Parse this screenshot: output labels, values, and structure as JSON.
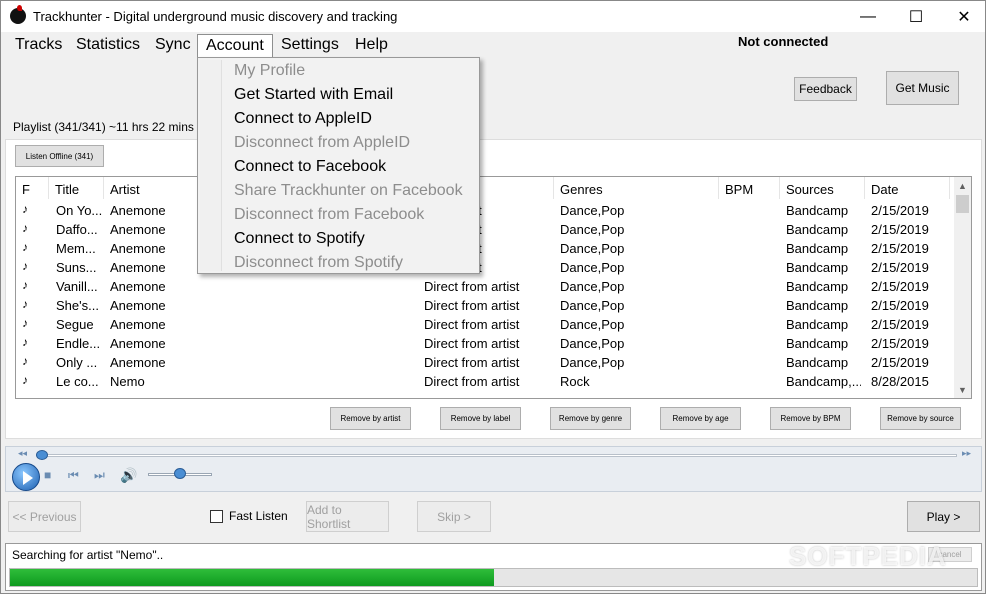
{
  "window": {
    "title": "Trackhunter - Digital underground music discovery and tracking",
    "controls": {
      "minimize": "—",
      "maximize": "☐",
      "close": "✕"
    }
  },
  "menubar": {
    "items": [
      "Tracks",
      "Statistics",
      "Sync",
      "Account",
      "Settings",
      "Help"
    ],
    "active": "Account"
  },
  "connection_status": "Not connected",
  "buttons": {
    "feedback": "Feedback",
    "get_music": "Get Music",
    "listen_offline": "Listen Offline (341)"
  },
  "playlist": {
    "label": "Playlist (341/341)   ~11 hrs 22 mins 0 s"
  },
  "account_menu": {
    "items": [
      {
        "label": "My Profile",
        "enabled": false
      },
      {
        "label": "Get Started with Email",
        "enabled": true
      },
      {
        "label": "Connect to AppleID",
        "enabled": true
      },
      {
        "label": "Disconnect from AppleID",
        "enabled": false
      },
      {
        "label": "Connect to Facebook",
        "enabled": true
      },
      {
        "label": "Share Trackhunter on Facebook",
        "enabled": false
      },
      {
        "label": "Disconnect from Facebook",
        "enabled": false
      },
      {
        "label": "Connect to Spotify",
        "enabled": true
      },
      {
        "label": "Disconnect from Spotify",
        "enabled": false
      }
    ]
  },
  "table": {
    "columns": [
      "F",
      "Title",
      "Artist",
      "Genres",
      "BPM",
      "Sources",
      "Date"
    ],
    "rows": [
      {
        "title": "On Yo...",
        "artist": "Anemone",
        "label": "from artist",
        "genres": "Dance,Pop",
        "bpm": "",
        "sources": "Bandcamp",
        "date": "2/15/2019"
      },
      {
        "title": "Daffo...",
        "artist": "Anemone",
        "label": "from artist",
        "genres": "Dance,Pop",
        "bpm": "",
        "sources": "Bandcamp",
        "date": "2/15/2019"
      },
      {
        "title": "Mem...",
        "artist": "Anemone",
        "label": "from artist",
        "genres": "Dance,Pop",
        "bpm": "",
        "sources": "Bandcamp",
        "date": "2/15/2019"
      },
      {
        "title": "Suns...",
        "artist": "Anemone",
        "label": "from artist",
        "genres": "Dance,Pop",
        "bpm": "",
        "sources": "Bandcamp",
        "date": "2/15/2019"
      },
      {
        "title": "Vanill...",
        "artist": "Anemone",
        "label": "Direct from artist",
        "genres": "Dance,Pop",
        "bpm": "",
        "sources": "Bandcamp",
        "date": "2/15/2019"
      },
      {
        "title": "She's...",
        "artist": "Anemone",
        "label": "Direct from artist",
        "genres": "Dance,Pop",
        "bpm": "",
        "sources": "Bandcamp",
        "date": "2/15/2019"
      },
      {
        "title": "Segue",
        "artist": "Anemone",
        "label": "Direct from artist",
        "genres": "Dance,Pop",
        "bpm": "",
        "sources": "Bandcamp",
        "date": "2/15/2019"
      },
      {
        "title": "Endle...",
        "artist": "Anemone",
        "label": "Direct from artist",
        "genres": "Dance,Pop",
        "bpm": "",
        "sources": "Bandcamp",
        "date": "2/15/2019"
      },
      {
        "title": "Only ...",
        "artist": "Anemone",
        "label": "Direct from artist",
        "genres": "Dance,Pop",
        "bpm": "",
        "sources": "Bandcamp",
        "date": "2/15/2019"
      },
      {
        "title": "Le co...",
        "artist": "Nemo",
        "label": "Direct from artist",
        "genres": "Rock",
        "bpm": "",
        "sources": "Bandcamp,...",
        "date": "8/28/2015"
      }
    ]
  },
  "remove_buttons": [
    "Remove by artist",
    "Remove by label",
    "Remove by genre",
    "Remove by age",
    "Remove by BPM",
    "Remove by source"
  ],
  "player": {
    "seek_position": 0.0,
    "volume": 0.5
  },
  "nav": {
    "previous": "<< Previous",
    "fast_listen": "Fast Listen",
    "add_to_shortlist": "Add to Shortlist",
    "skip": "Skip >",
    "play": "Play >"
  },
  "status": {
    "text": "Searching for artist \"Nemo\"..",
    "cancel": "cancel",
    "progress": 0.5
  },
  "watermark": "SOFTPEDIA"
}
